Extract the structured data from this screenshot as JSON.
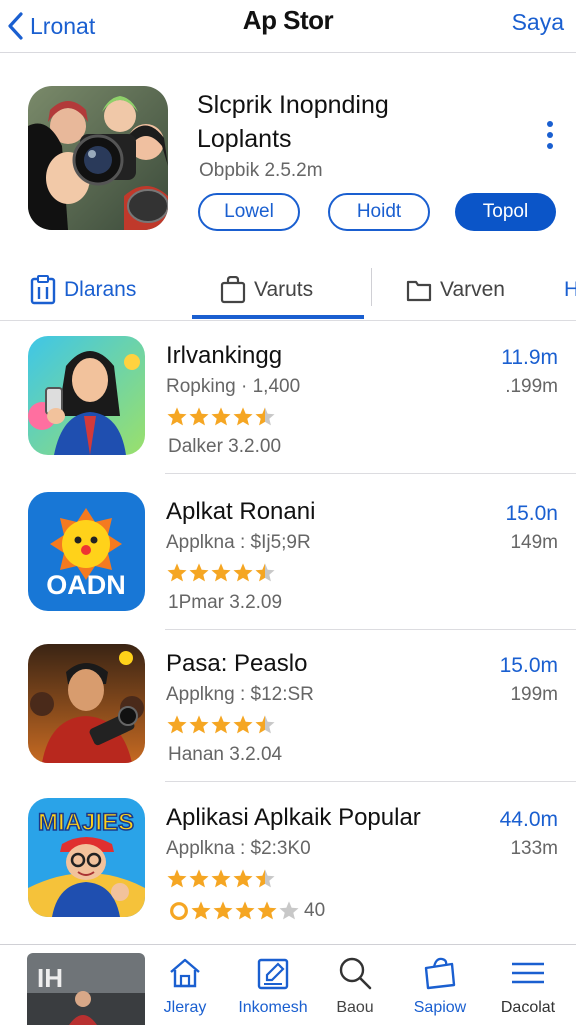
{
  "nav": {
    "back_label": "Lronat",
    "title": "Ap Stor",
    "action_label": "Saya"
  },
  "featured": {
    "name_line1": "Slcprik Inopnding",
    "name_line2": "Loplants",
    "meta": "Obpbik 2.5.2m",
    "buttons": [
      "Lowel",
      "Hoidt",
      "Topol"
    ]
  },
  "tabs": [
    {
      "label": "Dlarans",
      "icon": "clipboard-icon"
    },
    {
      "label": "Varuts",
      "icon": "bag-icon",
      "selected": true
    },
    {
      "label": "Varven",
      "icon": "folder-icon"
    },
    {
      "label": "H"
    }
  ],
  "apps": [
    {
      "name": "Irlvankingg",
      "sub": "Ropking · 1,400",
      "rating": 4.5,
      "footer": "Dalker 3.2.00",
      "size": "1.9m",
      "size_prefix": "1",
      "size_sub": ".199m",
      "icon": "woman-phone-icon"
    },
    {
      "name": "Aplkat Ronani",
      "sub": "Applkna : $Ij5;9R",
      "rating": 4.5,
      "footer": "1Pmar 3.2.09",
      "size": "15.0n",
      "size_sub": "149m",
      "icon": "sun-logo-icon",
      "icon_text": "OADN"
    },
    {
      "name": "Pasa: Peaslo",
      "sub": "Applkng : $12:SR",
      "rating": 4.5,
      "footer": "Hanan 3.2.04",
      "size": "15.0m",
      "size_sub": "199m",
      "icon": "camera-man-icon"
    },
    {
      "name": "Aplikasi Aplkaik Popular",
      "sub": "Applkna : $2:3K0",
      "rating": 4.5,
      "footer_rating": 4,
      "footer": "40",
      "size": "44.0m",
      "size_sub": "133m",
      "icon": "cartoon-boy-icon",
      "icon_text": "MIAJIES"
    }
  ],
  "tabbar": {
    "thumb_text": "IH",
    "items": [
      {
        "label": "Jleray",
        "icon": "home-icon"
      },
      {
        "label": "Inkomesh",
        "icon": "edit-icon"
      },
      {
        "label": "Baou",
        "icon": "search-icon"
      },
      {
        "label": "Sapiow",
        "icon": "bag-icon"
      },
      {
        "label": "Dacolat",
        "icon": "menu-icon"
      }
    ]
  },
  "colors": {
    "accent": "#1a5fd0",
    "star": "#f5a623"
  }
}
